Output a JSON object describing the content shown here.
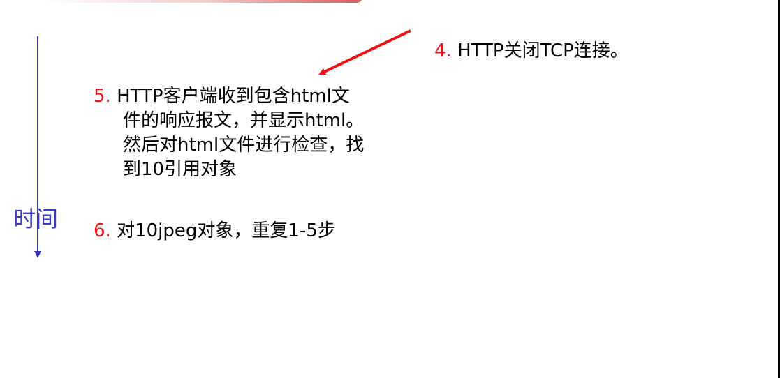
{
  "time_axis": {
    "label": "时间",
    "color": "#3333bb"
  },
  "arrow": {
    "color": "#ee1111",
    "direction": "from step 4 toward step 5"
  },
  "steps": [
    {
      "number": "4.",
      "lines": [
        "HTTP关闭TCP连接。"
      ]
    },
    {
      "number": "5.",
      "lines": [
        "HTTP客户端收到包含html文",
        "件的响应报文，并显示html。",
        "然后对html文件进行检查，找",
        "到10引用对象"
      ]
    },
    {
      "number": "6.",
      "lines": [
        "对10jpeg对象，重复1-5步"
      ]
    }
  ],
  "colors": {
    "step_number": "#ee1111",
    "text": "#000000",
    "time_axis": "#3333bb",
    "border": "#000000"
  }
}
